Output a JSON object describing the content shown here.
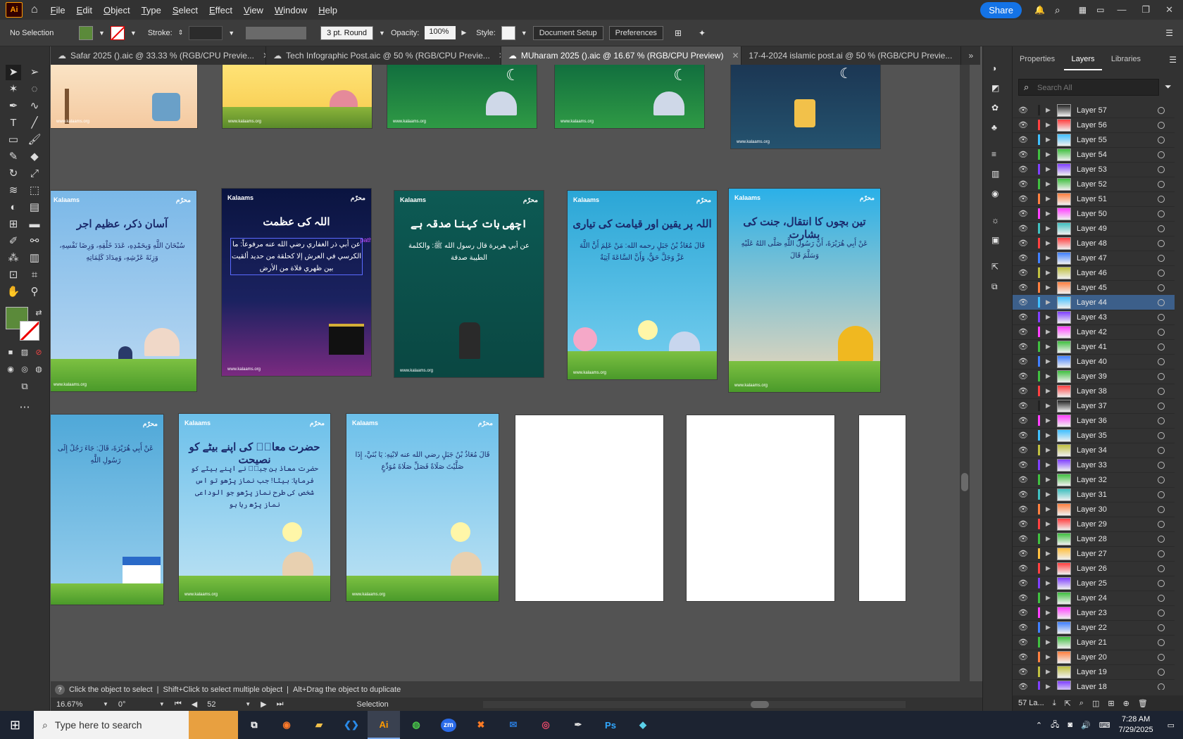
{
  "menubar": {
    "items": [
      "File",
      "Edit",
      "Object",
      "Type",
      "Select",
      "Effect",
      "View",
      "Window",
      "Help"
    ],
    "share_label": "Share"
  },
  "control": {
    "selection": "No Selection",
    "fill_color": "#5b8a3a",
    "stroke_label": "Stroke:",
    "brush": "3 pt. Round",
    "opacity_label": "Opacity:",
    "opacity_value": "100%",
    "style_label": "Style:",
    "doc_setup": "Document Setup",
    "preferences": "Preferences"
  },
  "tabs": [
    {
      "label": "Safar 2025 ().aic @ 33.33 % (RGB/CPU Previe...",
      "active": false
    },
    {
      "label": "Tech Infographic Post.aic @ 50 % (RGB/CPU Previe...",
      "active": false
    },
    {
      "label": "MUharam 2025 ().aic @ 16.67 % (RGB/CPU Preview)",
      "active": true
    },
    {
      "label": "17-4-2024 islamic post.ai @ 50 % (RGB/CPU Previe...",
      "active": false
    }
  ],
  "artboards": {
    "brand": "Kalaams",
    "site": "www.kalaams.org",
    "badge": "محرّم",
    "row2": [
      {
        "title": "آسان ذکر، عظیم اجر",
        "text": "سُبْحَانَ اللَّهِ وَبِحَمْدِهِ، عَدَدَ خَلْقِهِ، وَرِضَا نَفْسِهِ، وَزِنَةَ عَرْشِهِ، وَمِدَادَ كَلِمَاتِهِ",
        "bg": "#7ab8e8"
      },
      {
        "title": "اللہ کی عظمت",
        "text": "عن أبي ذر الغفاري رضي الله عنه مرفوعاً: ما الكرسي في العرش إلا كحلقة من حديد ألقيت بين ظهري فلاة من الأرض",
        "bg": "#0f1a4a",
        "path_label": "path"
      },
      {
        "title": "اچھی بات کہنا صدقہ ہے",
        "text": "عن أبي هريرة قال رسول الله ﷺ: والكلمة الطيبة صدقة",
        "bg": "#0d5a54"
      },
      {
        "title": "اللہ پر یقین اور قیامت کی تیاری",
        "text": "قَالَ مُعَاذُ بْنُ جَبَلٍ رحمه الله: مَنْ عَلِمَ أَنَّ اللَّهَ عَزَّ وَجَلَّ حَقٌّ، وَأَنَّ السَّاعَةَ آتِيَةٌ",
        "bg": "#2aa6d6"
      },
      {
        "title": "تین بچوں کا انتقال، جنت کی بشارت",
        "text": "عَنْ أَبِي هُرَيْرَةَ، أَنَّ رَسُولَ اللَّهِ صَلَّى اللهُ عَلَيْهِ وَسَلَّمَ قَالَ",
        "bg": "#5ab8e6"
      }
    ],
    "row3": [
      {
        "title": "",
        "text": "عَنْ أَبِي هُرَيْرَةَ، قَالَ: جَاءَ رَجُلٌ إِلَى رَسُولِ اللَّهِ",
        "bg": "#4fa8d8"
      },
      {
        "title": "حضرت معاذؓ کی اپنے بیٹے کو نصیحت",
        "text": "حضرت معاذ بن جبلؓ نے اپنے بیٹے کو فرمایا: بیٹا! جب نماز پڑھو تو اس شخص کی طرح نماز پڑھو جو الوداعی نماز پڑھ رہا ہو",
        "bg": "#6cc0ea"
      },
      {
        "title": "",
        "text": "قَالَ مُعَاذُ بْنُ جَبَلٍ رضي الله عنه لابْنِهِ: يَا بُنَيَّ، إِذَا صَلَّيْتَ صَلَاةً فَصَلِّ صَلَاةَ مُوَدِّعٍ",
        "bg": "#6cc0ea"
      }
    ]
  },
  "panels": {
    "tabs": [
      "Properties",
      "Layers",
      "Libraries"
    ],
    "search_placeholder": "Search All",
    "layer_count": "57 La...",
    "layers": [
      {
        "name": "Layer 57",
        "color": "#222222"
      },
      {
        "name": "Layer 56",
        "color": "#ff4040"
      },
      {
        "name": "Layer 55",
        "color": "#40c0ff"
      },
      {
        "name": "Layer 54",
        "color": "#40c040"
      },
      {
        "name": "Layer 53",
        "color": "#8040ff"
      },
      {
        "name": "Layer 52",
        "color": "#40c040"
      },
      {
        "name": "Layer 51",
        "color": "#ff8040"
      },
      {
        "name": "Layer 50",
        "color": "#ff40ff"
      },
      {
        "name": "Layer 49",
        "color": "#40c0c0"
      },
      {
        "name": "Layer 48",
        "color": "#ff4040"
      },
      {
        "name": "Layer 47",
        "color": "#4080ff"
      },
      {
        "name": "Layer 46",
        "color": "#c0c040"
      },
      {
        "name": "Layer 45",
        "color": "#ff8040"
      },
      {
        "name": "Layer 44",
        "color": "#40c0ff",
        "selected": true
      },
      {
        "name": "Layer 43",
        "color": "#8040ff"
      },
      {
        "name": "Layer 42",
        "color": "#ff40ff"
      },
      {
        "name": "Layer 41",
        "color": "#40c040"
      },
      {
        "name": "Layer 40",
        "color": "#4080ff"
      },
      {
        "name": "Layer 39",
        "color": "#40c040"
      },
      {
        "name": "Layer 38",
        "color": "#ff4040"
      },
      {
        "name": "Layer 37",
        "color": "#222222"
      },
      {
        "name": "Layer 36",
        "color": "#ff40ff"
      },
      {
        "name": "Layer 35",
        "color": "#40c0ff"
      },
      {
        "name": "Layer 34",
        "color": "#c0c040"
      },
      {
        "name": "Layer 33",
        "color": "#8040ff"
      },
      {
        "name": "Layer 32",
        "color": "#40c040"
      },
      {
        "name": "Layer 31",
        "color": "#40c0c0"
      },
      {
        "name": "Layer 30",
        "color": "#ff8040"
      },
      {
        "name": "Layer 29",
        "color": "#ff4040"
      },
      {
        "name": "Layer 28",
        "color": "#40c040"
      },
      {
        "name": "Layer 27",
        "color": "#ffc040"
      },
      {
        "name": "Layer 26",
        "color": "#ff4040"
      },
      {
        "name": "Layer 25",
        "color": "#8040ff"
      },
      {
        "name": "Layer 24",
        "color": "#40c040"
      },
      {
        "name": "Layer 23",
        "color": "#ff40ff"
      },
      {
        "name": "Layer 22",
        "color": "#4080ff"
      },
      {
        "name": "Layer 21",
        "color": "#40c040"
      },
      {
        "name": "Layer 20",
        "color": "#ff8040"
      },
      {
        "name": "Layer 19",
        "color": "#c0c040"
      },
      {
        "name": "Layer 18",
        "color": "#8040ff"
      }
    ]
  },
  "hint": {
    "text1": "Click the object to select",
    "text2": "Shift+Click to select multiple object",
    "text3": "Alt+Drag the object to duplicate"
  },
  "status": {
    "zoom": "16.67%",
    "rotation": "0°",
    "artboard": "52",
    "tool": "Selection"
  },
  "taskbar": {
    "search_placeholder": "Type here to search",
    "time": "7:28 AM",
    "date": "7/29/2025"
  }
}
